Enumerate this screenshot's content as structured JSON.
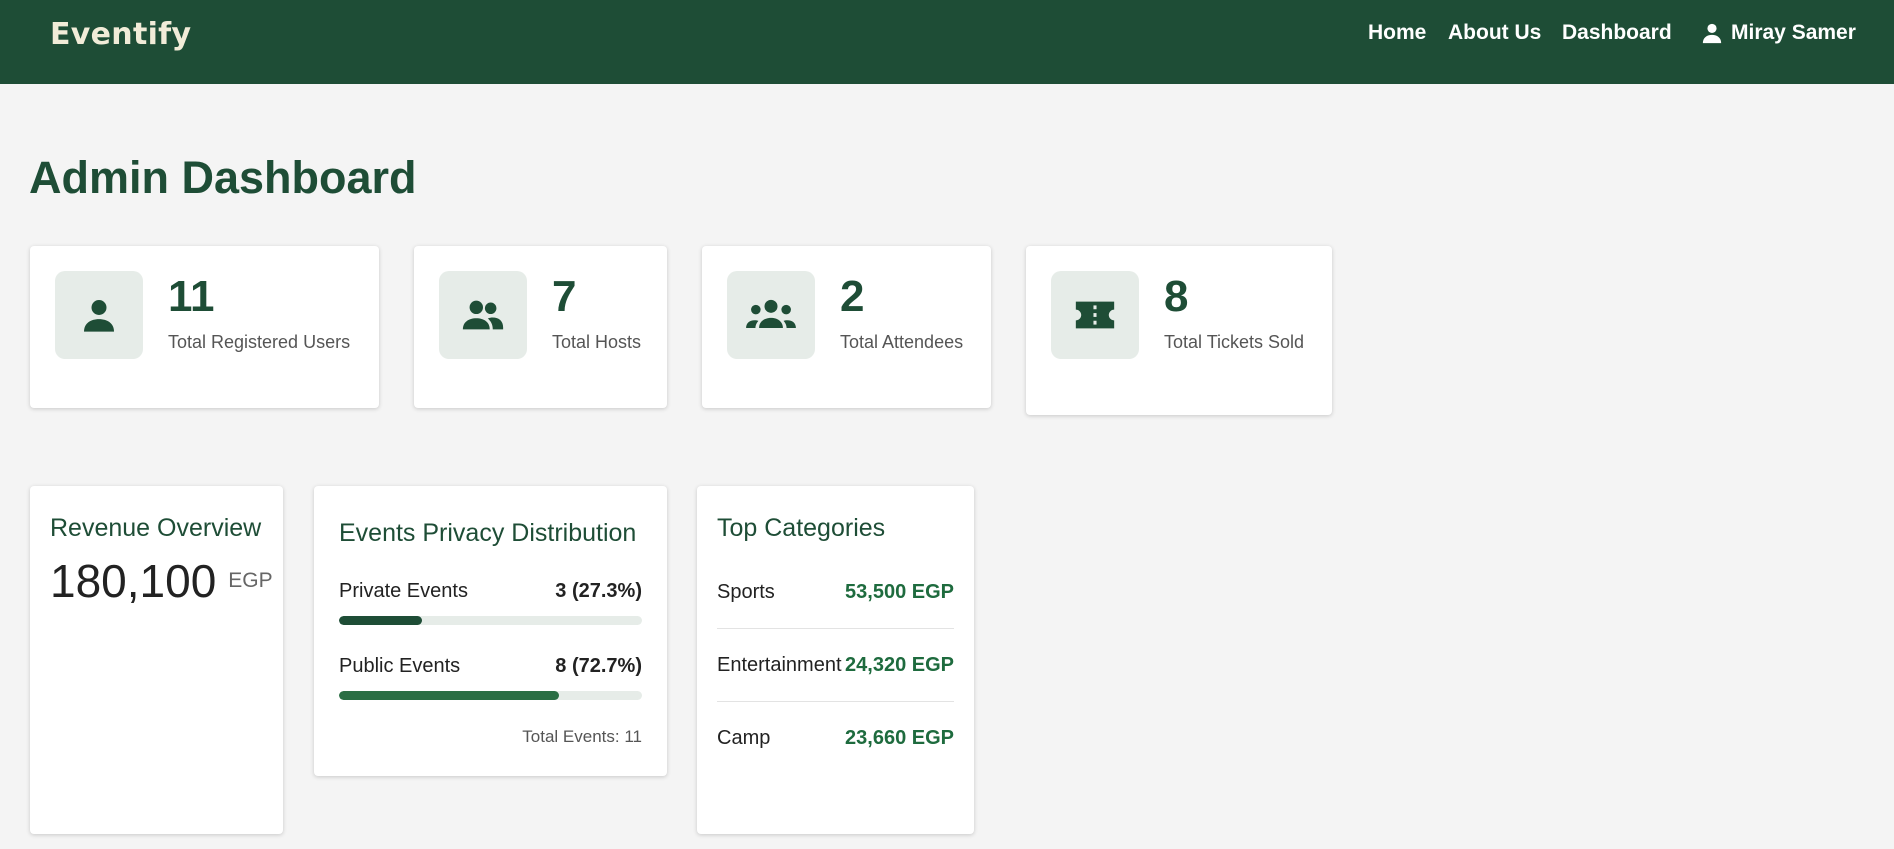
{
  "app": {
    "brand": "Eventify"
  },
  "nav": {
    "home": "Home",
    "about": "About Us",
    "dashboard": "Dashboard",
    "user_name": "Miray Samer"
  },
  "page": {
    "title": "Admin Dashboard"
  },
  "stats": [
    {
      "value": "11",
      "label": "Total Registered Users",
      "icon": "person-icon"
    },
    {
      "value": "7",
      "label": "Total Hosts",
      "icon": "people-icon"
    },
    {
      "value": "2",
      "label": "Total Attendees",
      "icon": "groups-icon"
    },
    {
      "value": "8",
      "label": "Total Tickets Sold",
      "icon": "ticket-icon"
    }
  ],
  "revenue": {
    "title": "Revenue Overview",
    "amount": "180,100",
    "currency": "EGP"
  },
  "privacy": {
    "title": "Events Privacy Distribution",
    "rows": [
      {
        "label": "Private Events",
        "value": "3 (27.3%)",
        "percent": 27.3,
        "color": "#1e4d36"
      },
      {
        "label": "Public Events",
        "value": "8 (72.7%)",
        "percent": 72.7,
        "color": "#2a6e44"
      }
    ],
    "total": "Total Events: 11"
  },
  "categories": {
    "title": "Top Categories",
    "items": [
      {
        "name": "Sports",
        "amount": "53,500 EGP"
      },
      {
        "name": "Entertainment",
        "amount": "24,320 EGP"
      },
      {
        "name": "Camp",
        "amount": "23,660 EGP"
      }
    ]
  },
  "colors": {
    "primary": "#1e4d36",
    "background": "#f4f4f4",
    "icon_tile": "#e6ece8",
    "category_value": "#1e6b3e"
  }
}
